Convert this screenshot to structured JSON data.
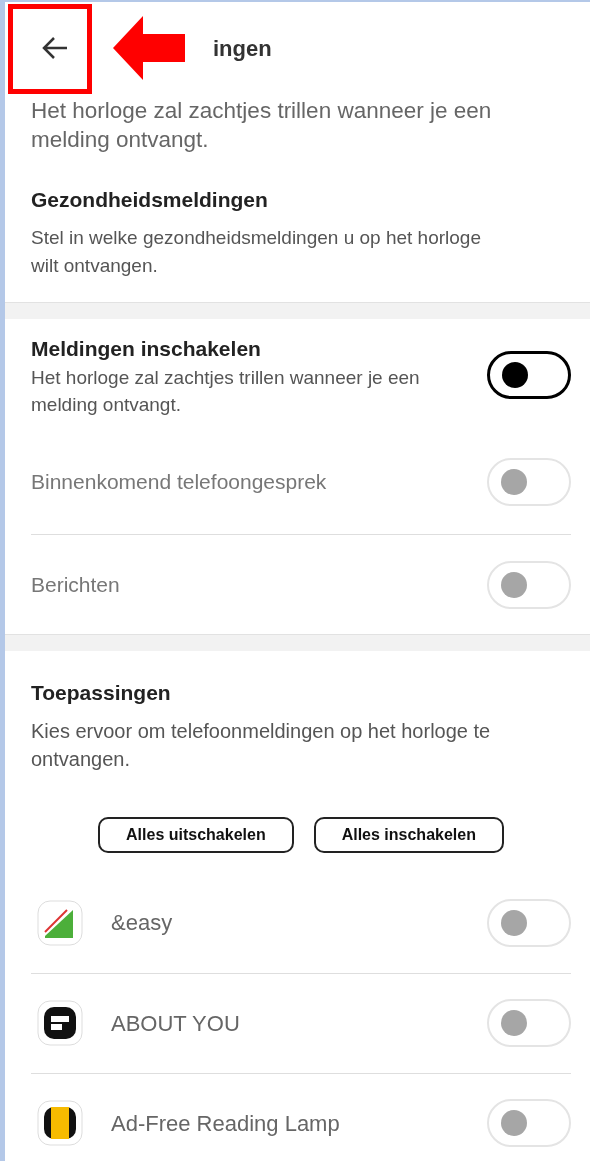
{
  "header": {
    "title": "ingen",
    "description": "Het horloge zal zachtjes trillen wanneer je een melding ontvangt."
  },
  "health": {
    "title": "Gezondheidsmeldingen",
    "description": "Stel in welke gezondheidsmeldingen u op het horloge wilt ontvangen."
  },
  "notifications": [
    {
      "kind": "main",
      "label": "Meldingen inschakelen",
      "description": "Het horloge zal zachtjes trillen wanneer je een melding ontvangt.",
      "on": false,
      "disabled": false
    },
    {
      "kind": "plain",
      "label": "Binnenkomend telefoongesprek",
      "on": false,
      "disabled": true
    },
    {
      "kind": "plain",
      "label": "Berichten",
      "on": false,
      "disabled": true
    }
  ],
  "apps_section": {
    "title": "Toepassingen",
    "description": "Kies ervoor om telefoonmeldingen op het horloge te ontvangen.",
    "buttons": [
      "Alles uitschakelen",
      "Alles inschakelen"
    ]
  },
  "apps": [
    {
      "kind": "easy",
      "label": "&easy",
      "on": false,
      "disabled": true
    },
    {
      "kind": "about",
      "label": "ABOUT YOU",
      "on": false,
      "disabled": true
    },
    {
      "kind": "lamp",
      "label": "Ad-Free Reading Lamp",
      "on": false,
      "disabled": true
    }
  ]
}
